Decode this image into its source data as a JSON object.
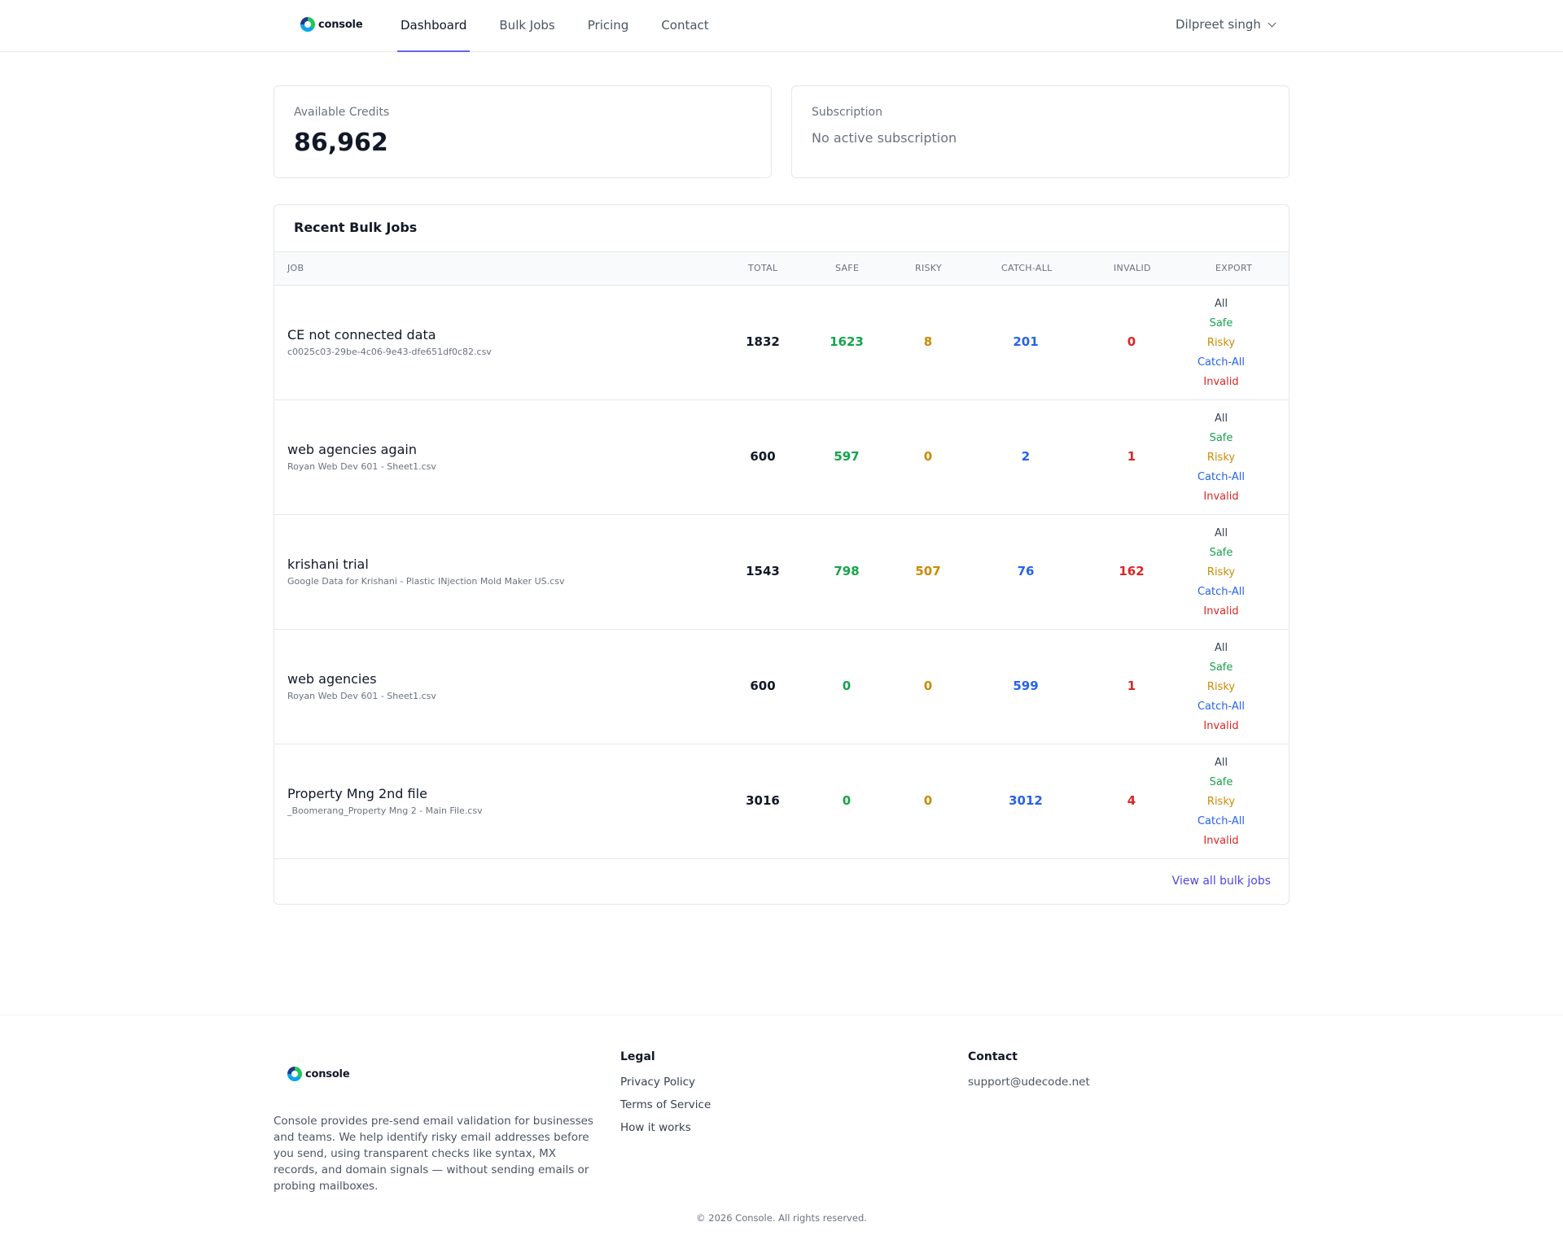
{
  "header": {
    "logo_text": "console",
    "nav": [
      {
        "label": "Dashboard",
        "active": true
      },
      {
        "label": "Bulk Jobs",
        "active": false
      },
      {
        "label": "Pricing",
        "active": false
      },
      {
        "label": "Contact",
        "active": false
      }
    ],
    "user_name": "Dilpreet singh"
  },
  "credits": {
    "label": "Available Credits",
    "value": "86,962"
  },
  "subscription": {
    "label": "Subscription",
    "value": "No active subscription"
  },
  "jobs": {
    "title": "Recent Bulk Jobs",
    "columns": [
      "JOB",
      "TOTAL",
      "SAFE",
      "RISKY",
      "CATCH-ALL",
      "INVALID",
      "EXPORT"
    ],
    "export_links": [
      "All",
      "Safe",
      "Risky",
      "Catch-All",
      "Invalid"
    ],
    "rows": [
      {
        "name": "CE not connected data",
        "file": "c0025c03-29be-4c06-9e43-dfe651df0c82.csv",
        "total": "1832",
        "safe": "1623",
        "risky": "8",
        "catch_all": "201",
        "invalid": "0"
      },
      {
        "name": "web agencies again",
        "file": "Royan Web Dev 601 - Sheet1.csv",
        "total": "600",
        "safe": "597",
        "risky": "0",
        "catch_all": "2",
        "invalid": "1"
      },
      {
        "name": "krishani trial",
        "file": "Google Data for Krishani - Plastic INjection Mold Maker US.csv",
        "total": "1543",
        "safe": "798",
        "risky": "507",
        "catch_all": "76",
        "invalid": "162"
      },
      {
        "name": "web agencies",
        "file": "Royan Web Dev 601 - Sheet1.csv",
        "total": "600",
        "safe": "0",
        "risky": "0",
        "catch_all": "599",
        "invalid": "1"
      },
      {
        "name": "Property Mng 2nd file",
        "file": "_Boomerang_Property Mng 2 - Main File.csv",
        "total": "3016",
        "safe": "0",
        "risky": "0",
        "catch_all": "3012",
        "invalid": "4"
      }
    ],
    "view_all": "View all bulk jobs"
  },
  "footer": {
    "logo_text": "console",
    "description": "Console provides pre-send email validation for businesses and teams. We help identify risky email addresses before you send, using transparent checks like syntax, MX records, and domain signals — without sending emails or probing mailboxes.",
    "legal": {
      "title": "Legal",
      "links": [
        "Privacy Policy",
        "Terms of Service",
        "How it works"
      ]
    },
    "contact": {
      "title": "Contact",
      "email": "support@udecode.net"
    },
    "copyright": "© 2026 Console. All rights reserved."
  },
  "colors": {
    "accent": "#6366f1",
    "safe": "#16a34a",
    "risky": "#ca8a04",
    "catch_all": "#2563eb",
    "invalid": "#dc2626",
    "link": "#4f46e5"
  }
}
